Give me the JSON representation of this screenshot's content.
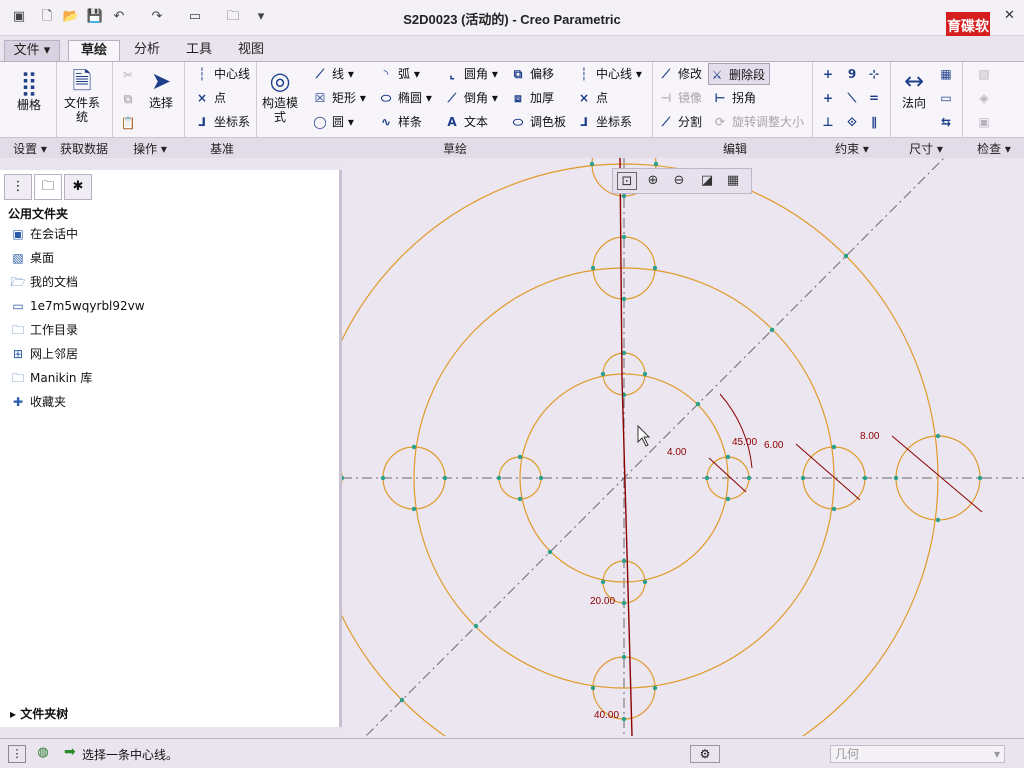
{
  "window": {
    "title": "S2D0023 (活动的) - Creo Parametric",
    "logo_text": "育碟软件",
    "help": "?"
  },
  "quick_access": [
    "new-icon",
    "open-icon",
    "save-icon",
    "undo-icon",
    "redo-icon",
    "window-icon",
    "folder-icon",
    "more-icon"
  ],
  "menu": {
    "file": "文件",
    "tabs": [
      "草绘",
      "分析",
      "工具",
      "视图"
    ],
    "active": "草绘"
  },
  "ribbon": {
    "setup": {
      "grid": "栅格"
    },
    "data": {
      "file_system": "文件系统"
    },
    "operations": {
      "select": "选择"
    },
    "datum": {
      "centerline": "中心线",
      "point": "点",
      "coord": "坐标系"
    },
    "construct": {
      "label": "构造模式"
    },
    "sketch": {
      "line": "线",
      "rect": "矩形",
      "circle": "圆",
      "arc": "弧",
      "ellipse": "椭圆",
      "spline": "样条",
      "fillet": "圆角",
      "chamfer": "倒角",
      "text": "文本",
      "offset": "偏移",
      "thicken": "加厚",
      "palette": "调色板",
      "centerline": "中心线",
      "point": "点",
      "coord": "坐标系"
    },
    "edit": {
      "modify": "修改",
      "delete_segment": "删除段",
      "mirror": "镜像",
      "corner": "拐角",
      "divide": "分割",
      "rotate_resize": "旋转调整大小"
    },
    "dimension": {
      "normal": "法向"
    },
    "groups": {
      "setup": "设置",
      "get_data": "获取数据",
      "operations": "操作",
      "datum": "基准",
      "sketch": "草绘",
      "edit": "编辑",
      "constrain": "约束",
      "dimension": "尺寸",
      "inspect": "检查"
    }
  },
  "navigator": {
    "title": "公用文件夹",
    "items": [
      {
        "label": "在会话中",
        "icon": "session-icon"
      },
      {
        "label": "桌面",
        "icon": "desktop-icon"
      },
      {
        "label": "我的文档",
        "icon": "documents-icon"
      },
      {
        "label": "1e7m5wqyrbl92vw",
        "icon": "computer-icon"
      },
      {
        "label": "工作目录",
        "icon": "working-dir-icon"
      },
      {
        "label": "网上邻居",
        "icon": "network-icon"
      },
      {
        "label": "Manikin 库",
        "icon": "library-icon"
      },
      {
        "label": "收藏夹",
        "icon": "favorites-icon"
      }
    ],
    "tree": "文件夹树"
  },
  "sketch": {
    "dims": {
      "d1": "4.00",
      "d2": "45.00",
      "d3": "6.00",
      "d4": "8.00",
      "d5": "20.00",
      "d6": "40.00"
    },
    "colors": {
      "geometry": "#e09a2a",
      "centerline": "#6a6a6a",
      "dimension": "#8b0000",
      "vertex": "#2aa08a"
    }
  },
  "status": {
    "message": "选择一条中心线。",
    "filter": "几何"
  }
}
